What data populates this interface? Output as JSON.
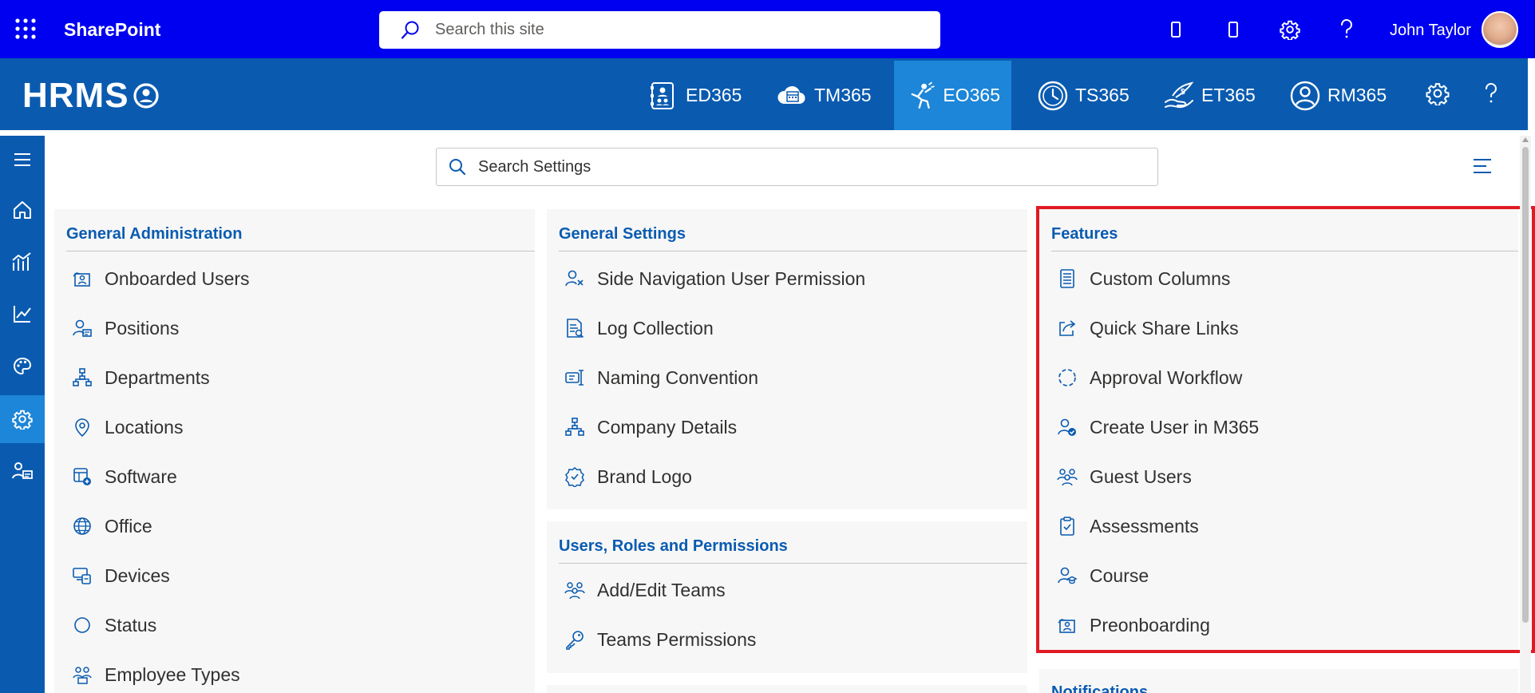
{
  "suite_bar": {
    "title": "SharePoint",
    "search_placeholder": "Search this site",
    "user_name": "John Taylor",
    "background": "#0000f0"
  },
  "app_bar": {
    "logo_text": "HRMS",
    "background": "#0a5bb0",
    "active_color": "#1d86d8",
    "tabs": [
      {
        "label": "ED365",
        "icon": "employee-directory-icon",
        "active": false
      },
      {
        "label": "TM365",
        "icon": "calendar-cloud-icon",
        "active": false
      },
      {
        "label": "EO365",
        "icon": "onboarding-person-icon",
        "active": true
      },
      {
        "label": "TS365",
        "icon": "clock-icon",
        "active": false
      },
      {
        "label": "ET365",
        "icon": "expense-hand-icon",
        "active": false
      },
      {
        "label": "RM365",
        "icon": "person-circle-icon",
        "active": false
      }
    ]
  },
  "left_rail": {
    "items": [
      {
        "icon": "hamburger-icon"
      },
      {
        "icon": "home-icon"
      },
      {
        "icon": "analytics-icon"
      },
      {
        "icon": "trend-chart-icon"
      },
      {
        "icon": "palette-icon"
      },
      {
        "icon": "gear-icon",
        "active": true
      },
      {
        "icon": "people-settings-icon"
      }
    ]
  },
  "settings_search": {
    "placeholder": "Search Settings"
  },
  "panels": {
    "general_admin": {
      "title": "General Administration",
      "items": [
        {
          "label": "Onboarded Users",
          "icon": "onboarded-users-icon"
        },
        {
          "label": "Positions",
          "icon": "position-icon"
        },
        {
          "label": "Departments",
          "icon": "org-chart-icon"
        },
        {
          "label": "Locations",
          "icon": "location-pin-icon"
        },
        {
          "label": "Software",
          "icon": "software-icon"
        },
        {
          "label": "Office",
          "icon": "globe-icon"
        },
        {
          "label": "Devices",
          "icon": "devices-icon"
        },
        {
          "label": "Status",
          "icon": "status-circle-icon"
        },
        {
          "label": "Employee Types",
          "icon": "employee-types-icon"
        }
      ]
    },
    "general_settings": {
      "title": "General Settings",
      "items": [
        {
          "label": "Side Navigation User Permission",
          "icon": "user-permission-icon"
        },
        {
          "label": "Log Collection",
          "icon": "log-icon"
        },
        {
          "label": "Naming Convention",
          "icon": "naming-icon"
        },
        {
          "label": "Company Details",
          "icon": "org-chart-icon"
        },
        {
          "label": "Brand Logo",
          "icon": "badge-icon"
        }
      ]
    },
    "users_roles": {
      "title": "Users, Roles and Permissions",
      "items": [
        {
          "label": "Add/Edit Teams",
          "icon": "teams-icon"
        },
        {
          "label": "Teams Permissions",
          "icon": "key-icon"
        }
      ]
    },
    "features": {
      "title": "Features",
      "items": [
        {
          "label": "Custom Columns",
          "icon": "columns-icon"
        },
        {
          "label": "Quick Share Links",
          "icon": "share-icon"
        },
        {
          "label": "Approval Workflow",
          "icon": "workflow-icon"
        },
        {
          "label": "Create User in M365",
          "icon": "create-user-icon"
        },
        {
          "label": "Guest Users",
          "icon": "guest-users-icon"
        },
        {
          "label": "Assessments",
          "icon": "clipboard-icon"
        },
        {
          "label": "Course",
          "icon": "course-icon"
        },
        {
          "label": "Preonboarding",
          "icon": "preonboarding-icon"
        }
      ]
    },
    "notifications": {
      "title": "Notifications"
    }
  },
  "highlight_color": "#e01b24"
}
